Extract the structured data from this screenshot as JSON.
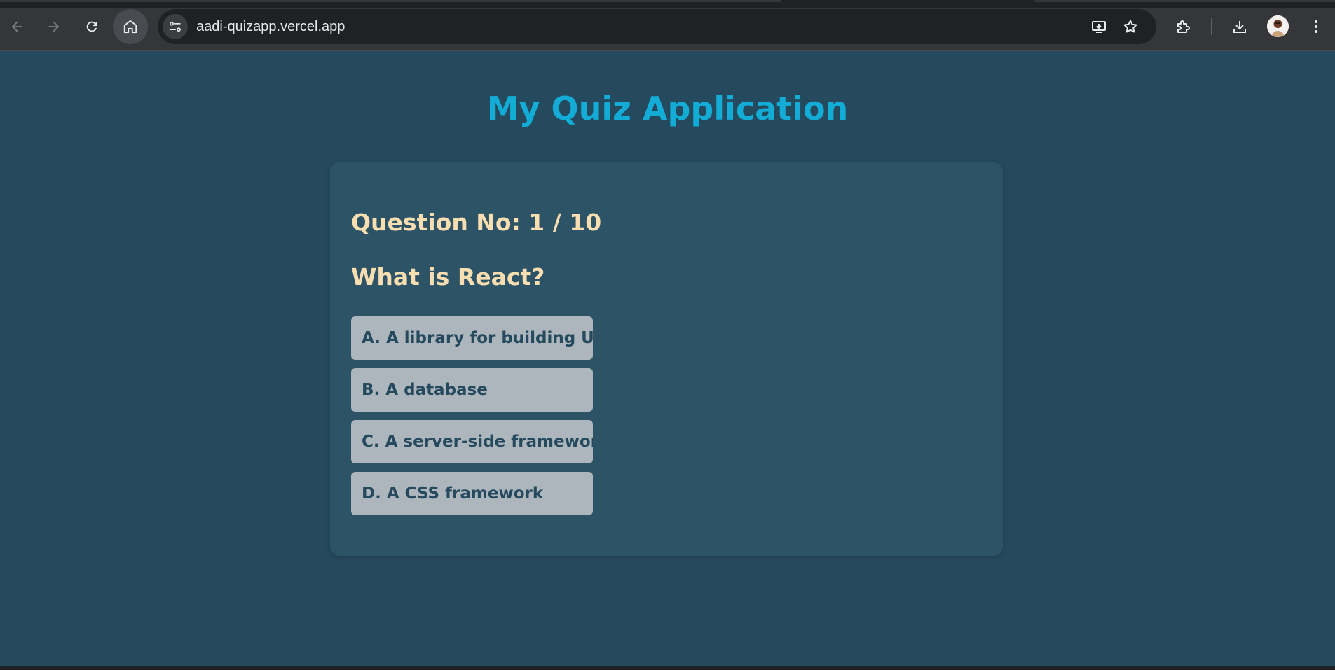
{
  "browser": {
    "url": "aadi-quizapp.vercel.app"
  },
  "page": {
    "title": "My Quiz Application"
  },
  "quiz": {
    "question_number": "Question No: 1 / 10",
    "question": "What is React?",
    "options": [
      "A. A library for building UI",
      "B. A database",
      "C. A server-side framework",
      "D. A CSS framework"
    ]
  },
  "colors": {
    "page_bg": "#254a5d",
    "card_bg": "#2d5466",
    "title": "#12acd6",
    "question_text": "#f9deb2",
    "option_bg": "#adb5bd",
    "option_text": "#254a5d"
  },
  "icons": {
    "back": "arrow-left-icon",
    "forward": "arrow-right-icon",
    "reload": "reload-icon",
    "home": "home-icon",
    "site_info": "tune-icon",
    "install": "install-app-icon",
    "bookmark": "star-icon",
    "extensions": "puzzle-icon",
    "downloads": "download-icon",
    "menu": "kebab-menu-icon"
  }
}
